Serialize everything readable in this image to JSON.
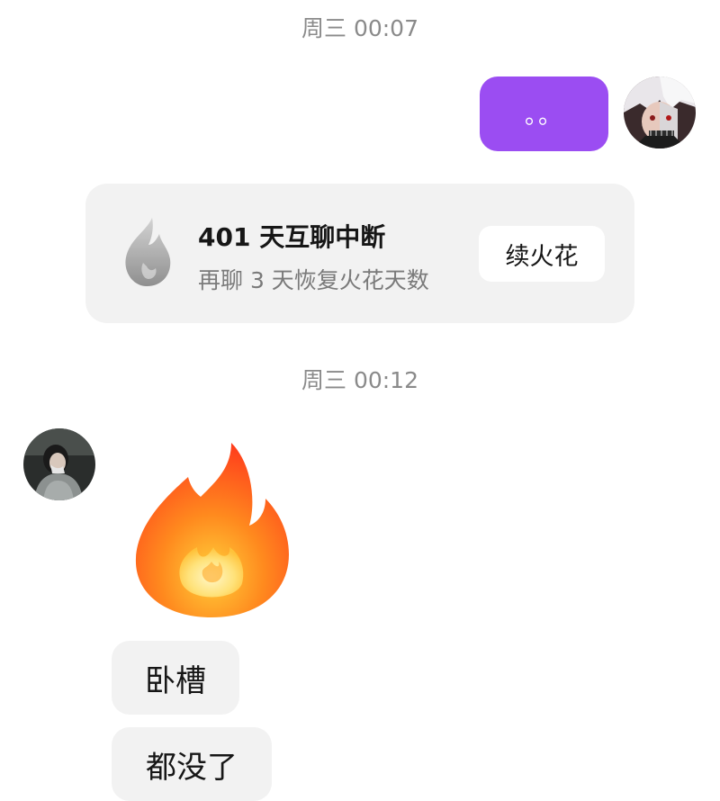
{
  "chat": {
    "timestamp_1": "周三 00:07",
    "self_message": "。。",
    "spark_card": {
      "title": "401 天互聊中断",
      "subtitle": "再聊 3 天恢复火花天数",
      "button_label": "续火花",
      "icon": "gray-flame-icon"
    },
    "timestamp_2": "周三 00:12",
    "peer_sticker": "fire-emoji-sticker",
    "peer_messages": [
      "卧槽",
      "都没了"
    ]
  },
  "colors": {
    "self_bubble": "#9b4df2",
    "peer_bubble": "#f2f2f2",
    "card_background": "#f2f2f2",
    "timestamp_text": "#8a8a8a"
  }
}
